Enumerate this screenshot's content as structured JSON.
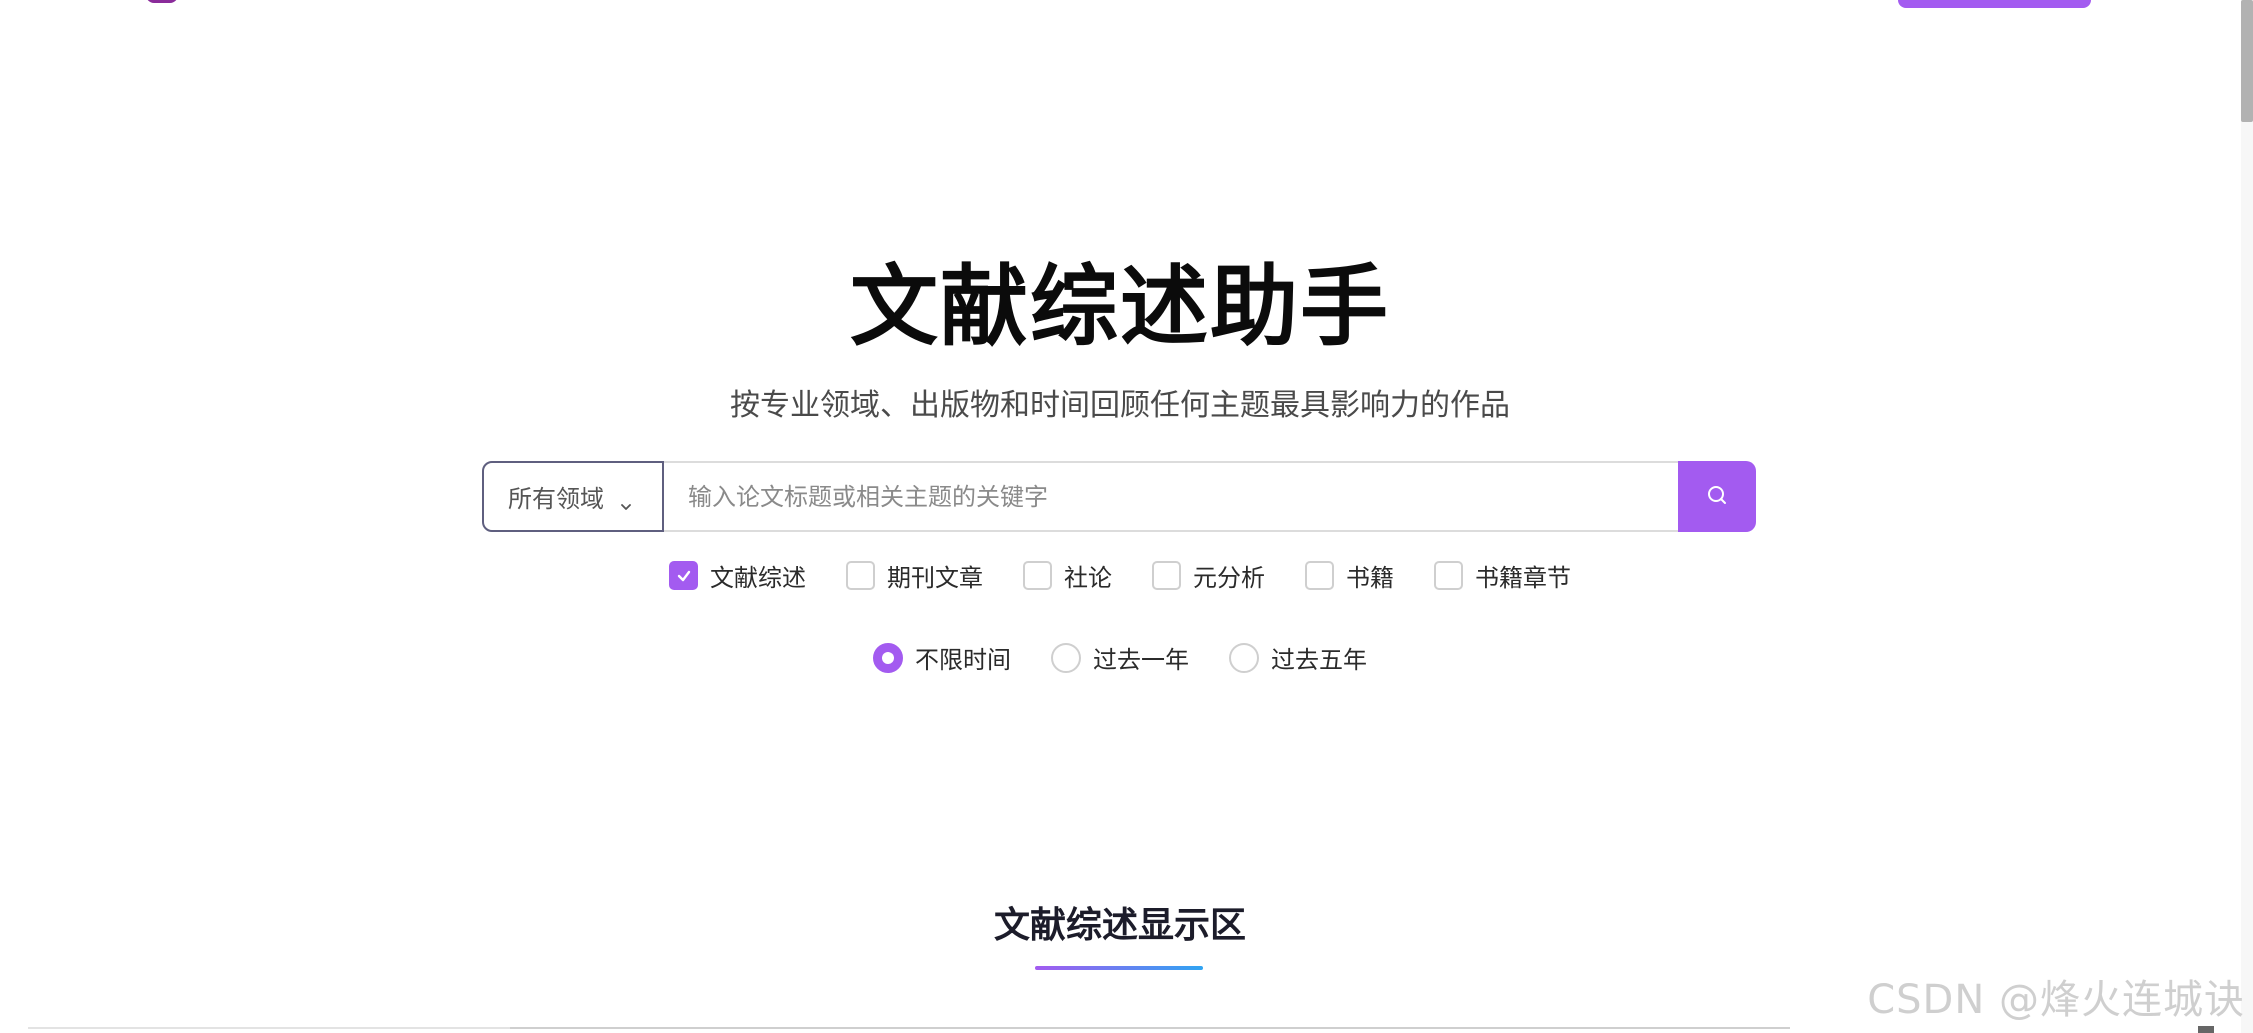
{
  "hero": {
    "title": "文献综述助手",
    "subtitle": "按专业领域、出版物和时间回顾任何主题最具影响力的作品"
  },
  "search": {
    "domain_selected": "所有领域",
    "placeholder": "输入论文标题或相关主题的关键字",
    "value": ""
  },
  "filters": [
    {
      "label": "文献综述",
      "checked": true
    },
    {
      "label": "期刊文章",
      "checked": false
    },
    {
      "label": "社论",
      "checked": false
    },
    {
      "label": "元分析",
      "checked": false
    },
    {
      "label": "书籍",
      "checked": false
    },
    {
      "label": "书籍章节",
      "checked": false
    }
  ],
  "time_filters": [
    {
      "label": "不限时间",
      "checked": true
    },
    {
      "label": "过去一年",
      "checked": false
    },
    {
      "label": "过去五年",
      "checked": false
    }
  ],
  "results_section": {
    "title": "文献综述显示区"
  },
  "watermark": "CSDN @烽火连城诀",
  "colors": {
    "accent": "#a35bf0",
    "gradient_end": "#2fa4f2"
  },
  "icons": {
    "search": "search-icon",
    "dropdown": "chevron-down-icon",
    "check": "check-icon"
  }
}
